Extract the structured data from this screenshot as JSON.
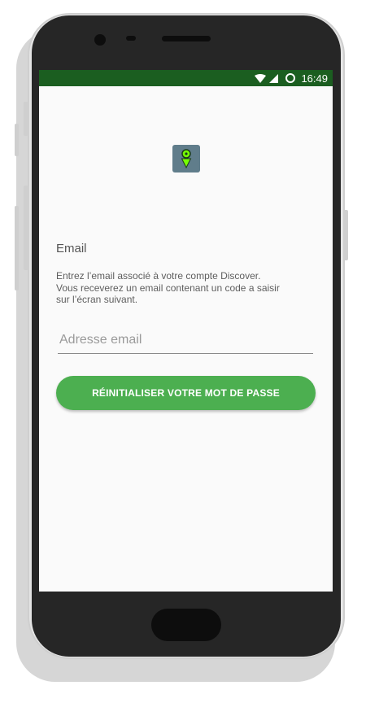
{
  "status_bar": {
    "time": "16:49",
    "icons": [
      "wifi-icon",
      "signal-icon",
      "sync-icon"
    ],
    "color": "#1b5e20"
  },
  "logo": {
    "icon": "map-pin-icon",
    "color": "#607d8b",
    "accent": "#76ff03"
  },
  "form": {
    "heading": "Email",
    "description_lines": [
      "Entrez l’email associé à votre compte Discover.",
      "Vous receverez un email contenant un code a saisir",
      "sur l’écran suivant."
    ],
    "email_input": {
      "placeholder": "Adresse email",
      "value": ""
    },
    "reset_button_label": "RÉINITIALISER VOTRE MOT DE PASSE",
    "accent_color": "#4caf50"
  }
}
